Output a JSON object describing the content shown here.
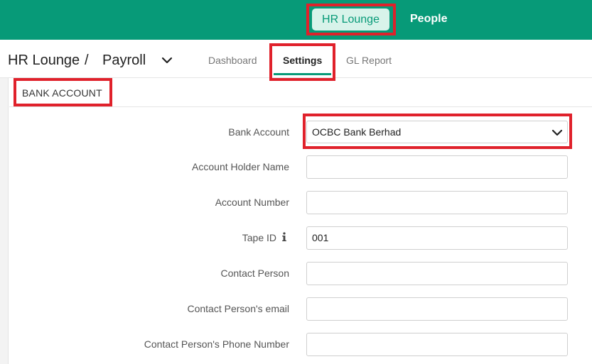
{
  "topbar": {
    "active_app": "HR Lounge",
    "people": "People"
  },
  "breadcrumb": {
    "root": "HR Lounge",
    "separator": "/",
    "current": "Payroll"
  },
  "tabs": [
    {
      "label": "Dashboard",
      "active": false
    },
    {
      "label": "Settings",
      "active": true
    },
    {
      "label": "GL Report",
      "active": false
    }
  ],
  "section": {
    "title": "BANK ACCOUNT"
  },
  "form": {
    "bank_account": {
      "label": "Bank Account",
      "value": "OCBC Bank Berhad"
    },
    "account_holder_name": {
      "label": "Account Holder Name",
      "value": ""
    },
    "account_number": {
      "label": "Account Number",
      "value": ""
    },
    "tape_id": {
      "label": "Tape ID",
      "value": "001"
    },
    "contact_person": {
      "label": "Contact Person",
      "value": ""
    },
    "contact_email": {
      "label": "Contact Person's email",
      "value": ""
    },
    "contact_phone": {
      "label": "Contact Person's Phone Number",
      "value": ""
    }
  },
  "colors": {
    "brand": "#079a78",
    "highlight": "#e0212b"
  }
}
